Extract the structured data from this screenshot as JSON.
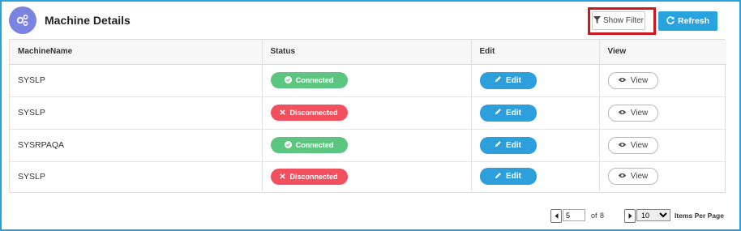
{
  "header": {
    "title": "Machine Details",
    "show_filter_label": "Show Filter",
    "refresh_label": "Refresh"
  },
  "table": {
    "columns": [
      "MachineName",
      "Status",
      "Edit",
      "View"
    ],
    "rows": [
      {
        "machine": "SYSLP",
        "status": "Connected",
        "edit": "Edit",
        "view": "View"
      },
      {
        "machine": "SYSLP",
        "status": "Disconnected",
        "edit": "Edit",
        "view": "View"
      },
      {
        "machine": "SYSRPAQA",
        "status": "Connected",
        "edit": "Edit",
        "view": "View"
      },
      {
        "machine": "SYSLP",
        "status": "Disconnected",
        "edit": "Edit",
        "view": "View"
      }
    ]
  },
  "pagination": {
    "current_page": "5",
    "of_label": "of",
    "total_pages": "8",
    "items_per_page": "10",
    "items_per_page_label": "Items Per Page"
  },
  "colors": {
    "accent": "#29a3dd",
    "connected": "#5cc680",
    "disconnected": "#f2505f",
    "highlight": "#d0161f"
  }
}
